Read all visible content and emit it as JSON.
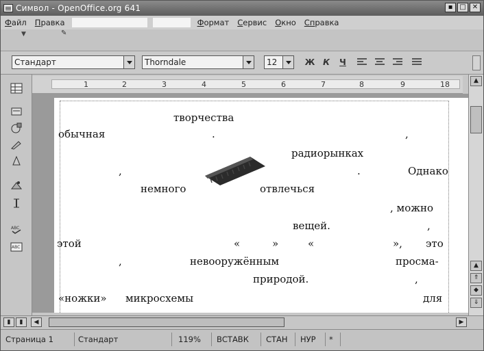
{
  "window": {
    "title": "Символ - OpenOffice.org 641"
  },
  "menu": {
    "items": [
      {
        "first": "Ф",
        "rest": "айл"
      },
      {
        "first": "П",
        "rest": "равка"
      },
      {
        "first": "Ф",
        "rest": "ормат"
      },
      {
        "first": "С",
        "rest": "ервис"
      },
      {
        "first": "О",
        "rest": "кно"
      },
      {
        "first": "Сп",
        "rest": "равка"
      }
    ]
  },
  "toolbar": {
    "style_value": "Стандарт",
    "font_value": "Thorndale",
    "size_value": "12",
    "bold": "Ж",
    "italic": "К",
    "underline": "Ч"
  },
  "ruler": {
    "ticks": [
      "1",
      "2",
      "3",
      "4",
      "5",
      "6",
      "7",
      "8",
      "9",
      "18"
    ]
  },
  "document": {
    "words": [
      "творчества",
      "обычная",
      ".",
      ",",
      "радиорынках",
      ",",
      ".",
      "Однако",
      "немного",
      "отвлечься",
      ", можно",
      "вещей.",
      ",",
      "этой",
      "«",
      "»",
      "«",
      "»,",
      "это",
      ",",
      "невооружённым",
      "просма-",
      "природой.",
      ",",
      "«ножки»",
      "микросхемы",
      "для"
    ]
  },
  "status": {
    "page": "Страница  1",
    "style": "Стандарт",
    "zoom": "119%",
    "insert": "ВСТАВК",
    "std": "СТАН",
    "hyp": "НУР",
    "star": "*"
  }
}
